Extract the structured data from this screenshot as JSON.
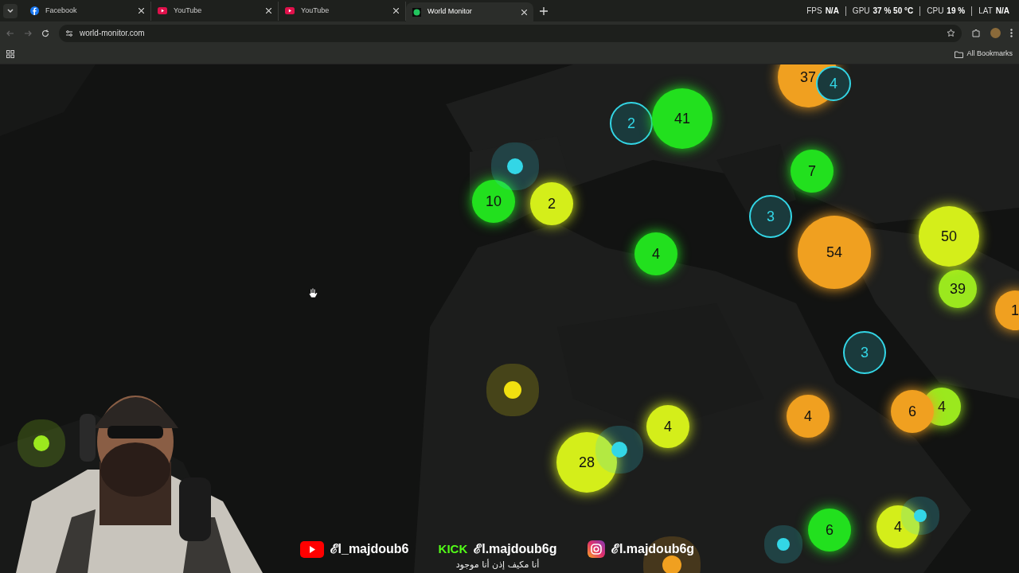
{
  "tabs": [
    {
      "label": "Facebook",
      "selected": false
    },
    {
      "label": "YouTube",
      "selected": false
    },
    {
      "label": "YouTube",
      "selected": false
    },
    {
      "label": "World Monitor",
      "selected": true
    }
  ],
  "perf_overlay": [
    {
      "label": "FPS",
      "value": "N/A"
    },
    {
      "label": "GPU",
      "value": "37 % 50 °C"
    },
    {
      "label": "CPU",
      "value": "19 %"
    },
    {
      "label": "LAT",
      "value": "N/A"
    }
  ],
  "address_bar": {
    "url": "world-monitor.com"
  },
  "bookmarks_bar": {
    "all_bookmarks": "All Bookmarks"
  },
  "map": {
    "markers": [
      {
        "kind": "cluster",
        "count": "37",
        "color": "#f0a020"
      },
      {
        "kind": "cluster",
        "count": "4",
        "color": "#33d6e6"
      },
      {
        "kind": "cluster",
        "count": "2",
        "color": "#33d6e6"
      },
      {
        "kind": "cluster",
        "count": "41",
        "color": "#22e01e"
      },
      {
        "kind": "cluster",
        "count": "7",
        "color": "#22e01e"
      },
      {
        "kind": "cluster",
        "count": "3",
        "color": "#33d6e6"
      },
      {
        "kind": "cluster",
        "count": "54",
        "color": "#f0a020"
      },
      {
        "kind": "cluster",
        "count": "39",
        "color": "#9be81e"
      },
      {
        "kind": "cluster",
        "count": "50",
        "color": "#d4ee1a"
      },
      {
        "kind": "cluster",
        "count": "1",
        "color": "#f0a020"
      },
      {
        "kind": "cluster",
        "count": "10",
        "color": "#22e01e"
      },
      {
        "kind": "cluster",
        "count": "2",
        "color": "#d4ee1a"
      },
      {
        "kind": "cluster",
        "count": "4",
        "color": "#22e01e"
      },
      {
        "kind": "cluster",
        "count": "3",
        "color": "#33d6e6"
      },
      {
        "kind": "cluster",
        "count": "4",
        "color": "#9be81e"
      },
      {
        "kind": "cluster",
        "count": "6",
        "color": "#f0a020"
      },
      {
        "kind": "cluster",
        "count": "4",
        "color": "#f0a020"
      },
      {
        "kind": "cluster",
        "count": "4",
        "color": "#d4ee1a"
      },
      {
        "kind": "cluster",
        "count": "28",
        "color": "#d4ee1a"
      },
      {
        "kind": "cluster",
        "count": "6",
        "color": "#22e01e"
      },
      {
        "kind": "cluster",
        "count": "4",
        "color": "#d4ee1a"
      },
      {
        "kind": "point",
        "color": "#33d6e6"
      },
      {
        "kind": "point",
        "color": "#f0e010"
      },
      {
        "kind": "point",
        "color": "#33d6e6"
      },
      {
        "kind": "point",
        "color": "#9be81e"
      },
      {
        "kind": "point",
        "color": "#33d6e6"
      },
      {
        "kind": "point",
        "color": "#33d6e6"
      },
      {
        "kind": "point",
        "color": "#f0a020"
      }
    ]
  },
  "stream_overlay": {
    "socials": [
      {
        "handle": "ℰl_majdoub6"
      },
      {
        "logo": "KICK",
        "handle": "ℰl.majdoub6g",
        "tagline": "أنا مكيف إذن أنا موجود"
      },
      {
        "handle": "ℰl.majdoub6g"
      }
    ]
  }
}
